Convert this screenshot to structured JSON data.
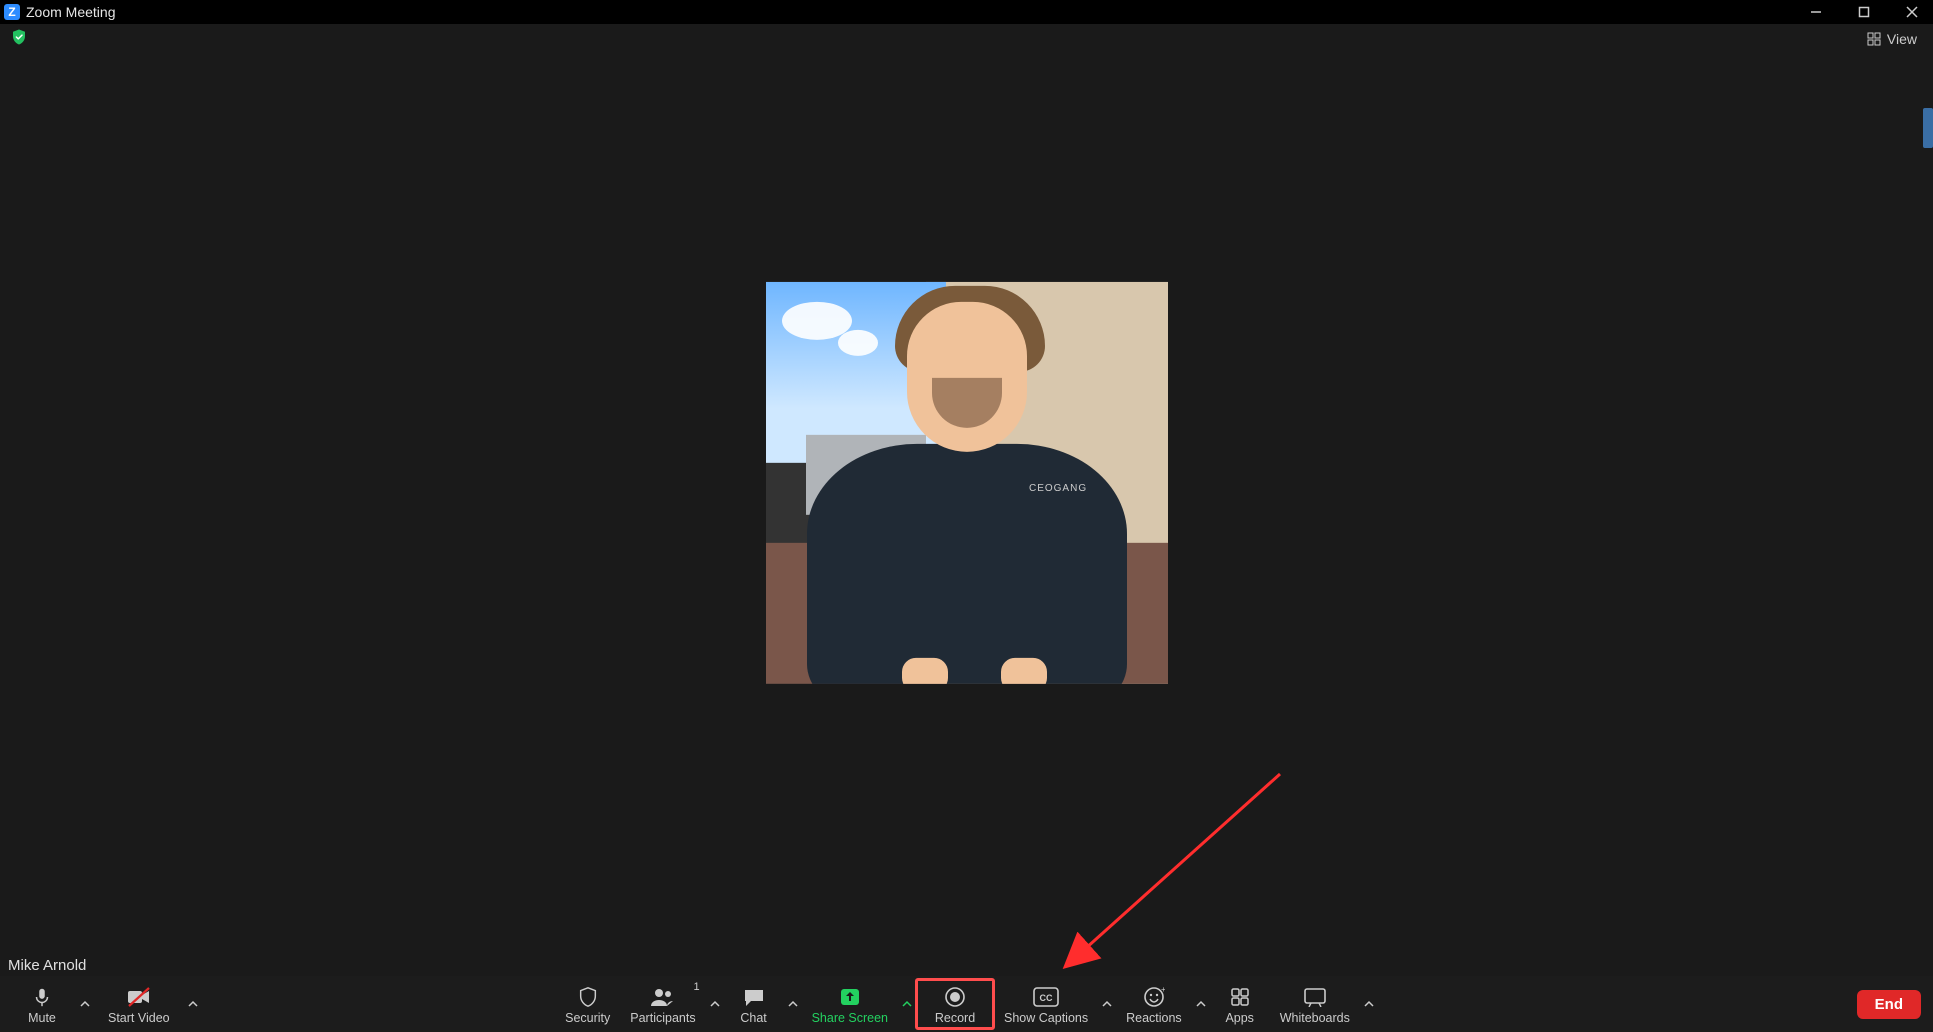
{
  "titlebar": {
    "app_icon_letter": "Z",
    "title": "Zoom Meeting"
  },
  "subbar": {
    "view_label": "View"
  },
  "participant": {
    "name": "Mike Arnold",
    "shirt_text": "CEOGANG"
  },
  "controls": {
    "mute": {
      "label": "Mute"
    },
    "start_video": {
      "label": "Start Video"
    },
    "security": {
      "label": "Security"
    },
    "participants": {
      "label": "Participants",
      "count": "1"
    },
    "chat": {
      "label": "Chat"
    },
    "share_screen": {
      "label": "Share Screen"
    },
    "record": {
      "label": "Record"
    },
    "show_captions": {
      "label": "Show Captions"
    },
    "reactions": {
      "label": "Reactions"
    },
    "apps": {
      "label": "Apps"
    },
    "whiteboards": {
      "label": "Whiteboards"
    },
    "end": {
      "label": "End"
    }
  }
}
